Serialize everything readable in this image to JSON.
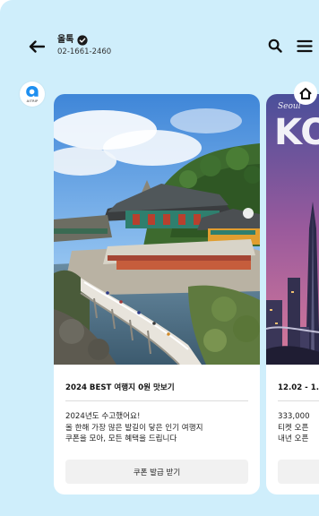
{
  "header": {
    "title": "올톡",
    "phone": "02-1661-2460"
  },
  "floating": {
    "aitrip_label": "AITRIP"
  },
  "cards": [
    {
      "title": "2024 BEST 여행지 0원 맛보기",
      "desc": [
        "2024년도 수고했어요!",
        "올 한해 가장 많은 발길이 닿은 인기 여행지",
        "쿠폰을 모아, 모든 혜택을 드립니다"
      ],
      "button": "쿠폰 발급 받기"
    },
    {
      "title": "12.02 - 1.",
      "image_text_small": "Seoul",
      "image_text_big": "KO",
      "desc": [
        "333,000 ",
        "티켓 오픈 ",
        "내년 오픈 "
      ],
      "button": ""
    }
  ],
  "colors": {
    "background": "#cfeefb",
    "card": "#ffffff",
    "verified": "#1a1a1a",
    "aitrip_blue": "#1e8ff0"
  }
}
